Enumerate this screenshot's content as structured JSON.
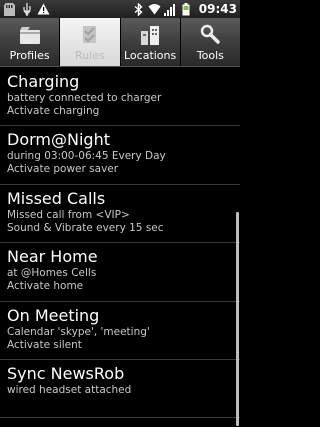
{
  "status_bar": {
    "time": "09:43",
    "left_icons": [
      "sd-card-icon",
      "usb-icon",
      "warning-icon"
    ],
    "right_icons": [
      "bluetooth-icon",
      "wifi-icon",
      "signal-icon",
      "battery-icon"
    ]
  },
  "tabs": [
    {
      "label": "Profiles",
      "icon": "profiles-icon",
      "active": false
    },
    {
      "label": "Rules",
      "icon": "rules-icon",
      "active": true
    },
    {
      "label": "Locations",
      "icon": "locations-icon",
      "active": false
    },
    {
      "label": "Tools",
      "icon": "tools-icon",
      "active": false
    }
  ],
  "rules": [
    {
      "title": "Charging",
      "line1": "battery connected to charger",
      "line2": "Activate charging"
    },
    {
      "title": "Dorm@Night",
      "line1": "during 03:00-06:45 Every Day",
      "line2": "Activate power saver"
    },
    {
      "title": "Missed Calls",
      "line1": "Missed call from <VIP>",
      "line2": "Sound & Vibrate every 15 sec"
    },
    {
      "title": "Near Home",
      "line1": "at @Homes Cells",
      "line2": "Activate home"
    },
    {
      "title": "On Meeting",
      "line1": "Calendar 'skype', 'meeting'",
      "line2": "Activate silent"
    },
    {
      "title": "Sync NewsRob",
      "line1": "wired headset attached",
      "line2": ""
    }
  ]
}
